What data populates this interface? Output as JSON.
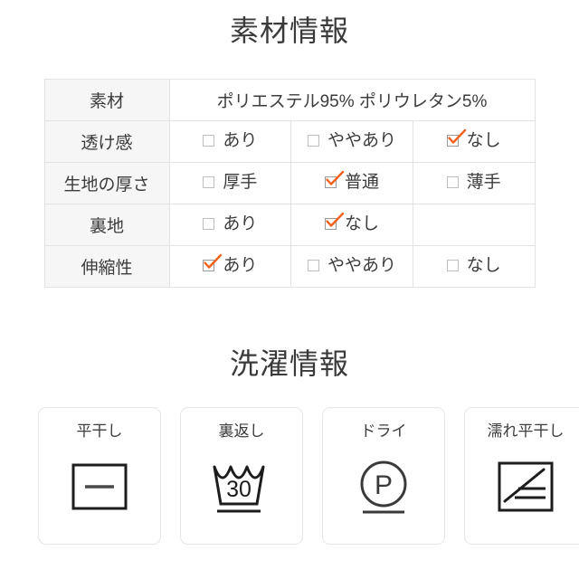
{
  "material_section": {
    "title": "素材情報",
    "table": {
      "rows": [
        {
          "label": "素材",
          "type": "text",
          "value": "ポリエステル95% ポリウレタン5%",
          "value_color": "#ff4d87"
        },
        {
          "label": "透け感",
          "type": "options",
          "options": [
            {
              "text": "あり",
              "checked": false
            },
            {
              "text": "ややあり",
              "checked": false
            },
            {
              "text": "なし",
              "checked": true
            }
          ]
        },
        {
          "label": "生地の厚さ",
          "type": "options",
          "options": [
            {
              "text": "厚手",
              "checked": false
            },
            {
              "text": "普通",
              "checked": true
            },
            {
              "text": "薄手",
              "checked": false
            }
          ]
        },
        {
          "label": "裏地",
          "type": "options",
          "options": [
            {
              "text": "あり",
              "checked": false
            },
            {
              "text": "なし",
              "checked": true
            },
            {
              "text": "",
              "checked": false,
              "empty": true
            }
          ]
        },
        {
          "label": "伸縮性",
          "type": "options",
          "options": [
            {
              "text": "あり",
              "checked": true
            },
            {
              "text": "ややあり",
              "checked": false
            },
            {
              "text": "なし",
              "checked": false
            }
          ]
        }
      ]
    }
  },
  "washing_section": {
    "title": "洗濯情報",
    "cards": [
      {
        "label": "平干し",
        "symbol": "flat-dry-symbol"
      },
      {
        "label": "裏返し",
        "symbol": "wash-tub-30-symbol",
        "symbol_value": "30"
      },
      {
        "label": "ドライ",
        "symbol": "dry-clean-p-symbol",
        "symbol_value": "P"
      },
      {
        "label": "濡れ平干し",
        "symbol": "wet-flat-dry-symbol"
      }
    ]
  },
  "colors": {
    "check_accent": "#f4601a",
    "material_pink": "#ff4d87",
    "title_gray": "#3a3a3a",
    "row_label_bg": "#f6f6f6",
    "table_border": "#e3e3e3",
    "card_border": "#e6e6e6"
  }
}
